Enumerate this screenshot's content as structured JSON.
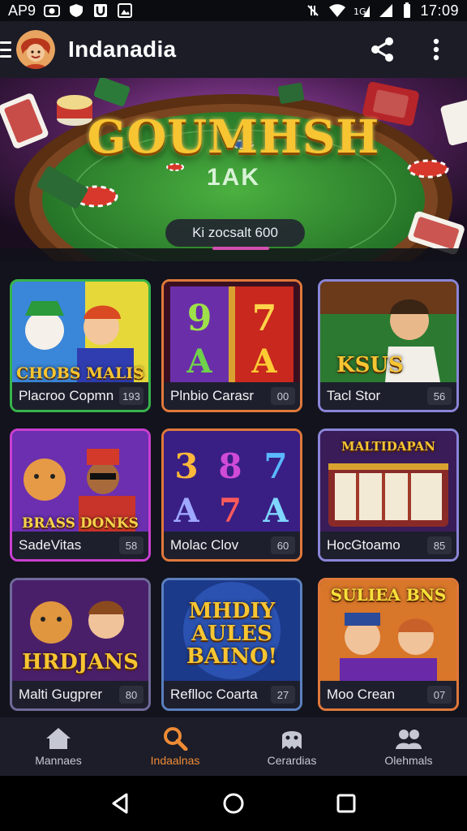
{
  "status_bar": {
    "carrier": "AP9",
    "time": "17:09"
  },
  "app_bar": {
    "title": "Indanadia",
    "icons": [
      "menu-icon",
      "avatar",
      "share-icon",
      "more-vert-icon"
    ]
  },
  "hero": {
    "title": "GOUMHSH",
    "subtitle": "1AK",
    "pill_text": "Ki zocsalt 600",
    "colors": {
      "felt": "#2f8a2e",
      "rim": "#5a2f12",
      "accent": "#d34fb0"
    }
  },
  "games": [
    {
      "label": "Placroo Copmn",
      "badge": "193",
      "art_text": "CHOBS MALIS",
      "border": "#37b34a"
    },
    {
      "label": "Plnbio Carasr",
      "badge": "00",
      "art_text": "9 7 A A",
      "border": "#e0783b"
    },
    {
      "label": "Tacl Stor",
      "badge": "56",
      "art_text": "KSUS",
      "border": "#8a85d8"
    },
    {
      "label": "SadeVitas",
      "badge": "58",
      "art_text": "BRASS DONKS",
      "border": "#c93fd0"
    },
    {
      "label": "Molac Clov",
      "badge": "60",
      "art_text": "3 8 7 A 7 A",
      "border": "#e0783b"
    },
    {
      "label": "HocGtoamo",
      "badge": "85",
      "art_text": "MALTIDAPAN",
      "border": "#8a85d8"
    },
    {
      "label": "Malti Gugprer",
      "badge": "80",
      "art_text": "HRDJANS",
      "border": "#6f6a9a"
    },
    {
      "label": "Reflloc Coarta",
      "badge": "27",
      "art_text": "MHDIY AULES BAINO!",
      "border": "#5b7fbf"
    },
    {
      "label": "Moo Crean",
      "badge": "07",
      "art_text": "SULIEA BNS",
      "border": "#e0783b"
    }
  ],
  "bottom_nav": [
    {
      "label": "Mannaes",
      "icon": "home-icon",
      "active": false
    },
    {
      "label": "Indaalnas",
      "icon": "search-icon",
      "active": true
    },
    {
      "label": "Cerardias",
      "icon": "ghost-icon",
      "active": false
    },
    {
      "label": "Olehmals",
      "icon": "people-icon",
      "active": false
    }
  ],
  "system_nav": [
    "back-icon",
    "home-circle-icon",
    "recents-icon"
  ]
}
